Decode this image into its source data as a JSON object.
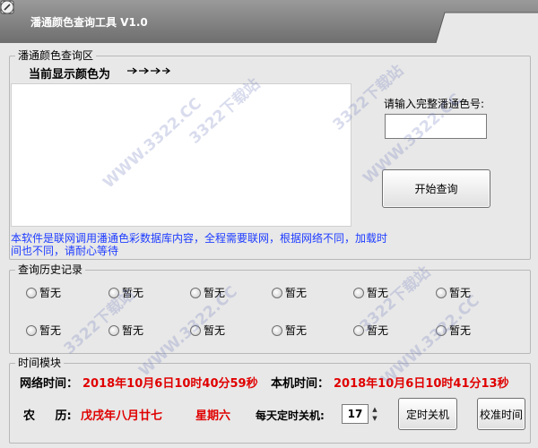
{
  "window": {
    "title": "潘通颜色查询工具    V1.0"
  },
  "query_section": {
    "title": "潘通颜色查询区",
    "current_color_label": "当前显示颜色为",
    "input_label": "请输入完整潘通色号:",
    "input_value": "",
    "query_button": "开始查询",
    "notice": "本软件是联网调用潘通色彩数据库内容，全程需要联网，根据网络不同，加载时间也不同，请耐心等待"
  },
  "history_section": {
    "title": "查询历史记录",
    "items": [
      "暂无",
      "暂无",
      "暂无",
      "暂无",
      "暂无",
      "暂无",
      "暂无",
      "暂无",
      "暂无",
      "暂无",
      "暂无",
      "暂无"
    ]
  },
  "time_section": {
    "title": "时间模块",
    "network_time_label": "网络时间：",
    "network_time_value": "2018年10月6日10时40分59秒",
    "local_time_label": "本机时间：",
    "local_time_value": "2018年10月6日10时41分13秒",
    "lunar_label": "农 历:",
    "lunar_value": "戊戌年八月廿七",
    "weekday": "星期六",
    "shutdown_label": "每天定时关机:",
    "shutdown_hour": "17",
    "timer_button": "定时关机",
    "calibrate_button": "校准时间"
  },
  "watermark": {
    "text": "3322下载站",
    "url": "WWW.3322.CC"
  },
  "colors": {
    "title_bar": "#858585",
    "accent_red": "#e00000",
    "notice_blue": "#1e3cff"
  }
}
